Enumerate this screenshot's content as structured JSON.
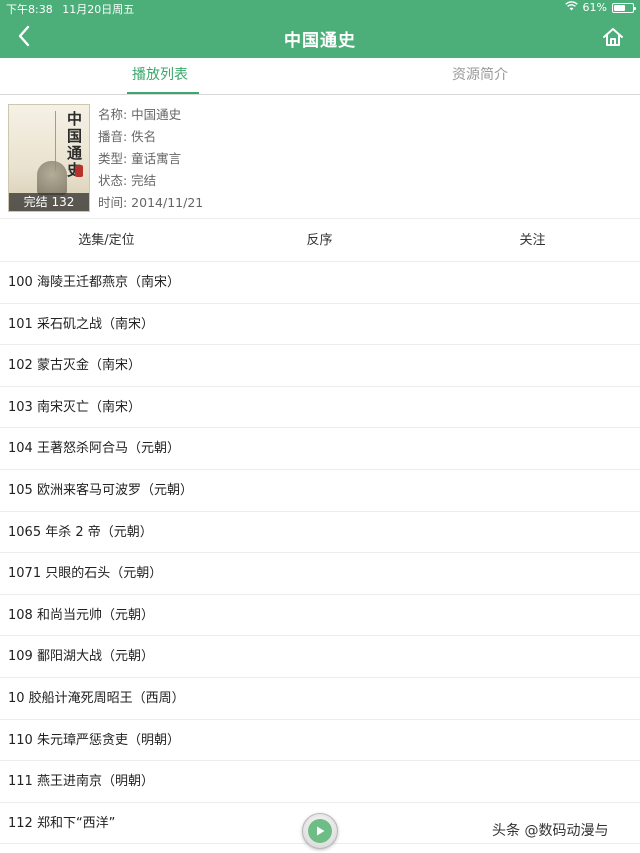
{
  "status_bar": {
    "time": "下午8:38",
    "date": "11月20日周五",
    "battery": "61%",
    "battery_level": 0.61,
    "wifi_icon": "wifi-icon"
  },
  "nav": {
    "title": "中国通史",
    "back_icon": "chevron-left-icon",
    "home_icon": "home-icon"
  },
  "tabs": [
    {
      "label": "播放列表",
      "active": true
    },
    {
      "label": "资源简介",
      "active": false
    }
  ],
  "book": {
    "cover_title": "中国通史",
    "cover_badge": "完结 132",
    "name": "名称: 中国通史",
    "narrator": "播音: 佚名",
    "category": "类型: 童话寓言",
    "state": "状态: 完结",
    "time": "时间: 2014/11/21"
  },
  "actions": [
    "选集/定位",
    "反序",
    "关注"
  ],
  "episodes": [
    "100 海陵王迁都燕京（南宋）",
    "101 采石矶之战（南宋）",
    "102 蒙古灭金（南宋）",
    "103 南宋灭亡（南宋）",
    "104 王著怒杀阿合马（元朝）",
    "105 欧洲来客马可波罗（元朝）",
    "1065 年杀 2 帝（元朝）",
    "1071 只眼的石头（元朝）",
    "108 和尚当元帅（元朝）",
    "109 鄱阳湖大战（元朝）",
    "10 胶船计淹死周昭王（西周）",
    "110 朱元璋严惩贪吏（明朝）",
    "111 燕王进南京（明朝）",
    "112 郑和下“西洋”"
  ],
  "player": {
    "icon": "play-icon"
  },
  "watermark": "头条 @数码动漫与"
}
